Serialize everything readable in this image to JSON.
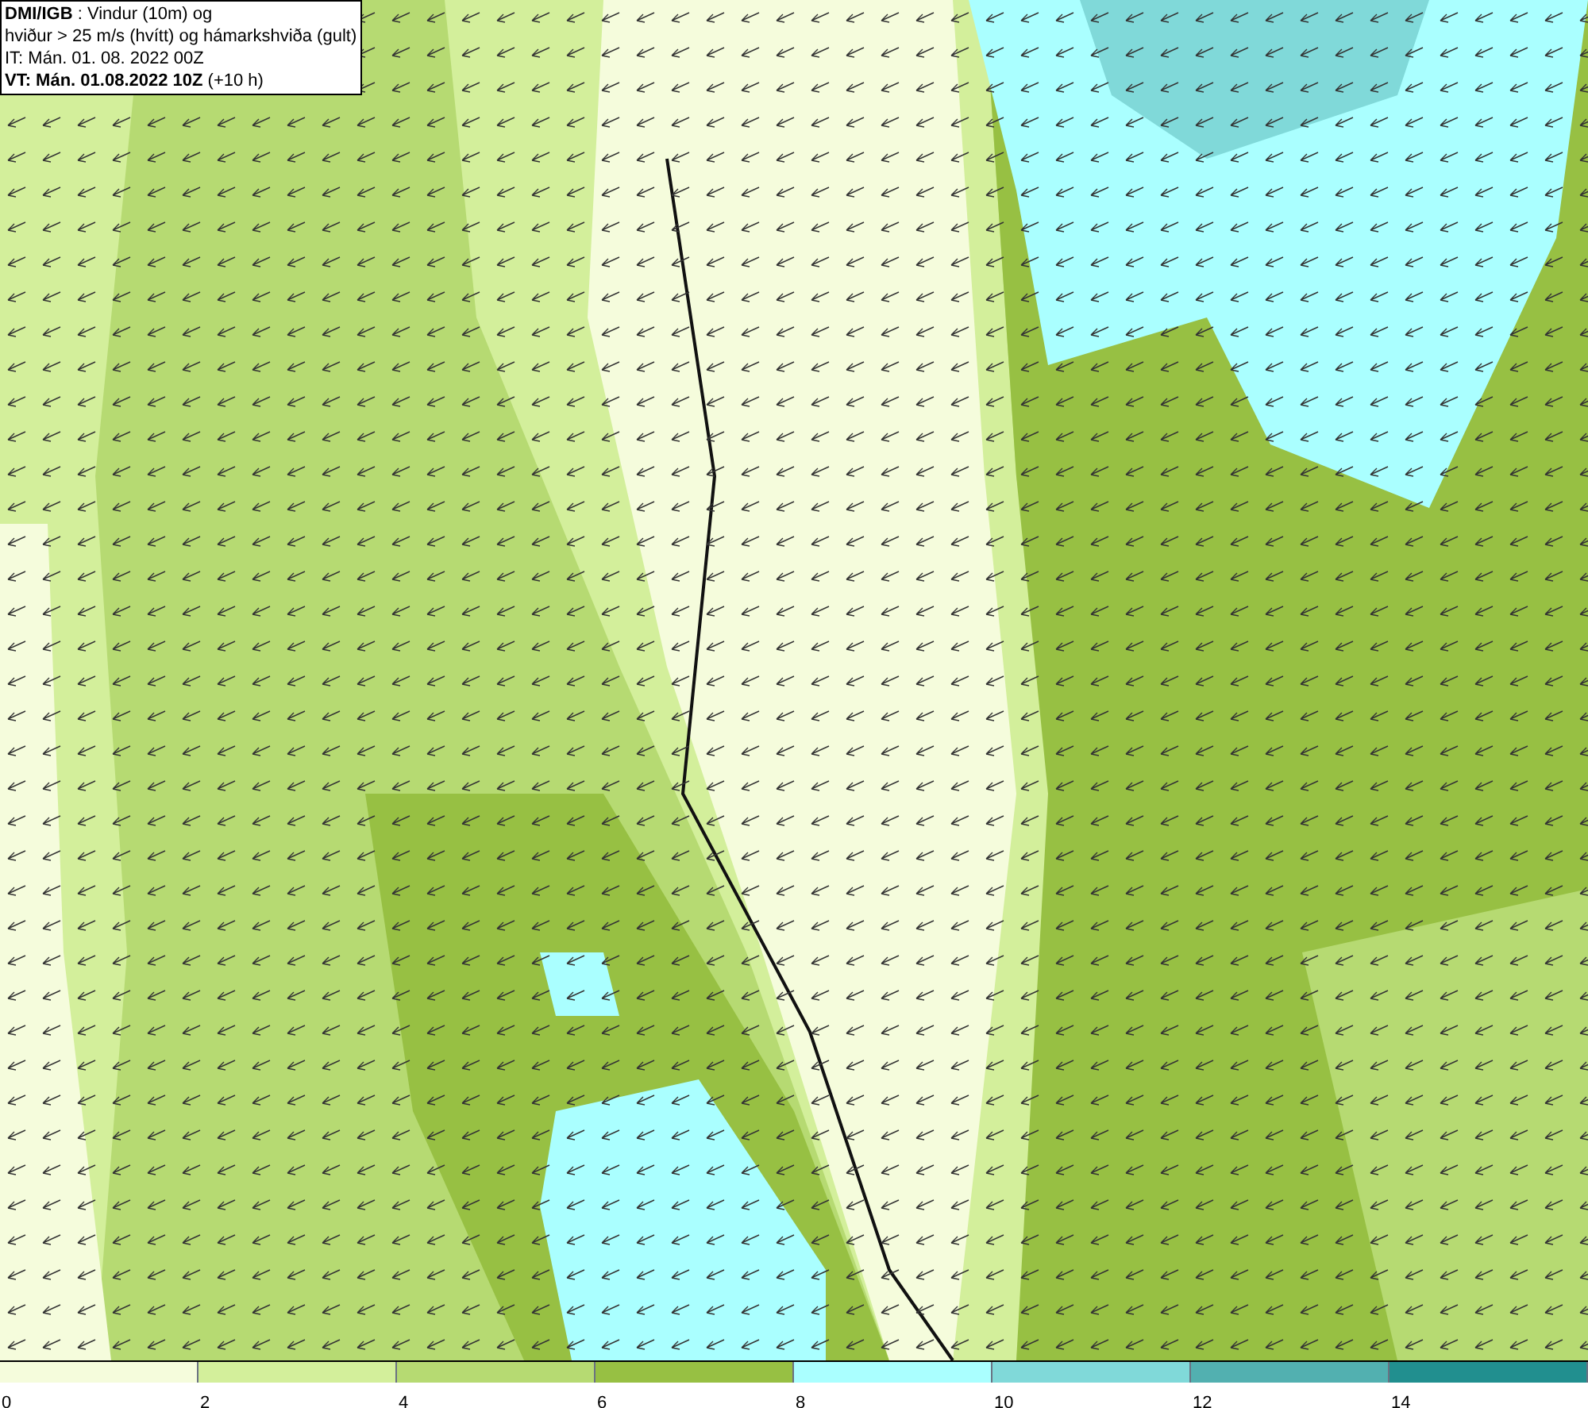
{
  "title_box": {
    "lines": [
      "**DMI/IGB** : Vindur (10m) og",
      "hviður > 25 m/s (hvítt) og hámarkshviða (gult)",
      "IT: Mán. 01. 08. 2022 00Z",
      "**VT: Mán. 01.08.2022 10Z** (+10 h)"
    ]
  },
  "legend": [
    {
      "label": "0",
      "color": "#f5fcdc"
    },
    {
      "label": "2",
      "color": "#d3ef9b"
    },
    {
      "label": "4",
      "color": "#b6da72"
    },
    {
      "label": "6",
      "color": "#97c043"
    },
    {
      "label": "8",
      "color": "#aaffff"
    },
    {
      "label": "10",
      "color": "#80d9d9"
    },
    {
      "label": "12",
      "color": "#52b0b0"
    },
    {
      "label": "14",
      "color": "#218f8f"
    }
  ]
}
